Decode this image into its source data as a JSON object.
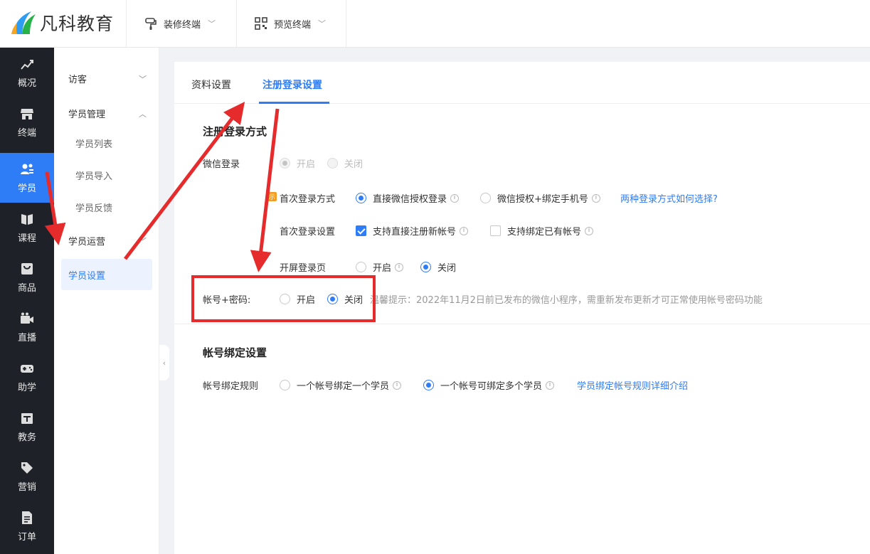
{
  "header": {
    "logo_text": "凡科教育",
    "decorate_terminal": "装修终端",
    "preview_terminal": "预览终端"
  },
  "sidebar": {
    "items": [
      {
        "label": "概况",
        "icon": "chart-icon"
      },
      {
        "label": "终端",
        "icon": "store-icon"
      },
      {
        "label": "学员",
        "icon": "users-icon"
      },
      {
        "label": "课程",
        "icon": "book-icon"
      },
      {
        "label": "商品",
        "icon": "bag-icon"
      },
      {
        "label": "直播",
        "icon": "video-icon"
      },
      {
        "label": "助学",
        "icon": "gamepad-icon"
      },
      {
        "label": "教务",
        "icon": "calendar-icon"
      },
      {
        "label": "营销",
        "icon": "tag-icon"
      },
      {
        "label": "订单",
        "icon": "document-icon"
      }
    ],
    "active": "学员"
  },
  "subnav": {
    "visitor": "访客",
    "student_mgmt": "学员管理",
    "student_list": "学员列表",
    "student_import": "学员导入",
    "student_feedback": "学员反馈",
    "student_ops": "学员运营",
    "student_settings": "学员设置"
  },
  "tabs": {
    "profile": "资料设置",
    "register": "注册登录设置",
    "active": "注册登录设置"
  },
  "register_section": {
    "title": "注册登录方式",
    "wechat_label": "微信登录",
    "wechat_on": "开启",
    "wechat_off": "关闭",
    "first_login_method_label": "首次登录方式",
    "first_login_direct": "直接微信授权登录",
    "first_login_bind": "微信授权+绑定手机号",
    "first_login_help_link": "两种登录方式如何选择?",
    "first_login_settings_label": "首次登录设置",
    "allow_register": "支持直接注册新帐号",
    "allow_bind": "支持绑定已有帐号",
    "splash_label": "开屏登录页",
    "splash_on": "开启",
    "splash_off": "关闭",
    "account_password_label": "帐号+密码:",
    "account_password_on": "开启",
    "account_password_off": "关闭",
    "account_password_tip": "温馨提示：2022年11月2日前已发布的微信小程序，需重新发布更新才可正常使用帐号密码功能"
  },
  "binding_section": {
    "title": "帐号绑定设置",
    "rule_label": "帐号绑定规则",
    "one_to_one": "一个帐号绑定一个学员",
    "one_to_many": "一个帐号可绑定多个学员",
    "rule_link": "学员绑定帐号规则详细介绍"
  },
  "colors": {
    "accent": "#2e7cf6",
    "sidebar_bg": "#1e2127",
    "annotation_red": "#e52b2b"
  }
}
